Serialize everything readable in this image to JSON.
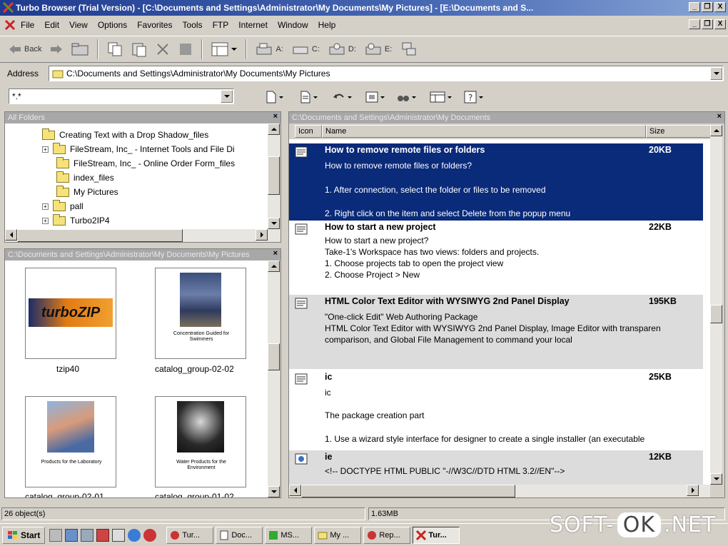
{
  "window": {
    "title": "Turbo Browser (Trial Version) - [C:\\Documents and Settings\\Administrator\\My Documents\\My Pictures] - [E:\\Documents and S...",
    "min": "_",
    "restore": "❐",
    "close": "X"
  },
  "menu": [
    "File",
    "Edit",
    "View",
    "Options",
    "Favorites",
    "Tools",
    "FTP",
    "Internet",
    "Window",
    "Help"
  ],
  "toolbar": {
    "back": "Back",
    "drives": [
      "A:",
      "C:",
      "D:",
      "E:"
    ]
  },
  "address": {
    "label": "Address",
    "value": "C:\\Documents and Settings\\Administrator\\My Documents\\My Pictures"
  },
  "filter": {
    "value": "*.*"
  },
  "folders_pane": {
    "title": "All Folders",
    "items": [
      {
        "label": "Creating Text with a Drop Shadow_files",
        "expander": ""
      },
      {
        "label": "FileStream, Inc_ - Internet Tools and File Di",
        "expander": "+"
      },
      {
        "label": "FileStream, Inc_ - Online Order Form_files",
        "expander": ""
      },
      {
        "label": "index_files",
        "expander": ""
      },
      {
        "label": "My Pictures",
        "expander": ""
      },
      {
        "label": "pall",
        "expander": "+"
      },
      {
        "label": "Turbo2IP4",
        "expander": "+"
      }
    ]
  },
  "thumbs_pane": {
    "title": "C:\\Documents and Settings\\Administrator\\My Documents\\My Pictures",
    "items": [
      {
        "label": "tzip40",
        "art": "turboZIP"
      },
      {
        "label": "catalog_group-02-02",
        "art": "Concentration Guided for Swimmers"
      },
      {
        "label": "catalog_group-02-01",
        "art": "Products for the Laboratory"
      },
      {
        "label": "catalog_group-01-02",
        "art": "Water Products for the Environment"
      }
    ]
  },
  "list_pane": {
    "title": "C:\\Documents and Settings\\Administrator\\My Documents",
    "columns": [
      "Icon",
      "Name",
      "Size"
    ],
    "rows": [
      {
        "name": "How to remove remote files or folders",
        "size": "20KB",
        "lines": [
          "How to remove remote files or folders?",
          "",
          "1. After connection, select the folder or files to be removed",
          "",
          "2. Right click on the item and select Delete from the popup menu"
        ]
      },
      {
        "name": "How to start a new project",
        "size": "22KB",
        "lines": [
          "How to start a new project?",
          "Take-1's Workspace has two views: folders and projects.",
          "1.          Choose projects tab to open the project view",
          "2.          Choose Project > New"
        ]
      },
      {
        "name": "HTML Color Text Editor with WYSIWYG 2nd Panel Display",
        "size": "195KB",
        "lines": [
          "\"One-click Edit\" Web Authoring Package",
          "HTML Color Text Editor with WYSIWYG 2nd Panel Display, Image Editor with transparen",
          "comparison, and Global File Management to command your local"
        ]
      },
      {
        "name": "ic",
        "size": "25KB",
        "lines": [
          "ic",
          "",
          "The package creation part",
          "",
          "1. Use a wizard style interface for designer to create a single installer (an executable"
        ]
      },
      {
        "name": "ie",
        "size": "12KB",
        "lines": [
          "<!-- DOCTYPE HTML PUBLIC \"-//W3C//DTD HTML 3.2//EN\"-->"
        ]
      }
    ]
  },
  "status": {
    "objects": "26 object(s)",
    "size": "1.63MB"
  },
  "taskbar": {
    "start": "Start",
    "tasks": [
      "Tur...",
      "Doc...",
      "MS...",
      "My ...",
      "Rep...",
      "Tur..."
    ],
    "active_index": 5
  },
  "watermark": {
    "pre": "SOFT-",
    "ok": "OK",
    "post": ".NET"
  },
  "colors": {
    "title_bar": "#1f3b8f",
    "selection": "#0a2a7a",
    "face": "#d4d0c8"
  }
}
